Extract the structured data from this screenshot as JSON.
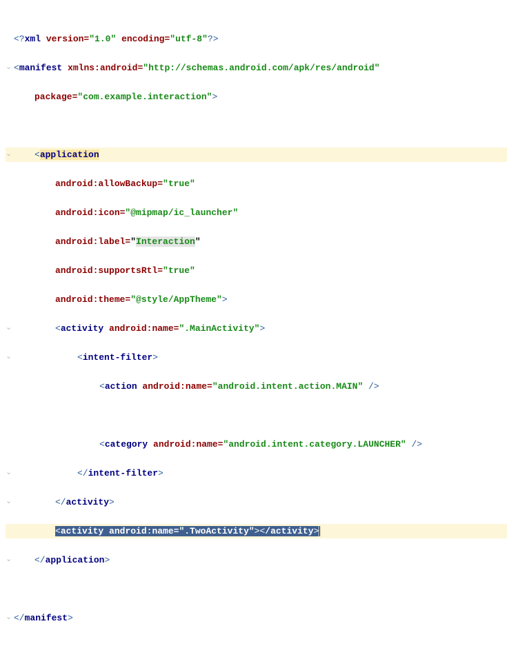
{
  "gutter": {
    "collapse": "⌄"
  },
  "line1": {
    "open": "<?",
    "tag": "xml",
    "attr1": "version=",
    "val1": "\"1.0\"",
    "attr2": " encoding=",
    "val2": "\"utf-8\"",
    "close": "?>"
  },
  "line2": {
    "open": "<",
    "tag": "manifest",
    "attr1": " xmlns:android=",
    "val1": "\"http://schemas.android.com/apk/res/android\""
  },
  "line3": {
    "attr": "package=",
    "val": "\"com.example.interaction\"",
    "close": ">"
  },
  "line5": {
    "open": "<",
    "tag": "application"
  },
  "line6": {
    "attr": "android:allowBackup=",
    "val": "\"true\""
  },
  "line7": {
    "attr": "android:icon=",
    "val": "\"@mipmap/ic_launcher\""
  },
  "line8": {
    "attr": "android:label=",
    "q1": "\"",
    "val": "Interaction",
    "q2": "\""
  },
  "line9": {
    "attr": "android:supportsRtl=",
    "val": "\"true\""
  },
  "line10": {
    "attr": "android:theme=",
    "val": "\"@style/AppTheme\"",
    "close": ">"
  },
  "line11": {
    "open": "<",
    "tag": "activity",
    "attr": " android:name=",
    "val": "\".MainActivity\"",
    "close": ">"
  },
  "line12": {
    "open": "<",
    "tag": "intent-filter",
    "close": ">"
  },
  "line13": {
    "open": "<",
    "tag": "action",
    "attr": " android:name=",
    "val": "\"android.intent.action.MAIN\"",
    "close": " />"
  },
  "line15": {
    "open": "<",
    "tag": "category",
    "attr": " android:name=",
    "val": "\"android.intent.category.LAUNCHER\"",
    "close": " />"
  },
  "line16": {
    "open": "</",
    "tag": "intent-filter",
    "close": ">"
  },
  "line17": {
    "open": "</",
    "tag": "activity",
    "close": ">"
  },
  "line18": {
    "open": "<",
    "tag": "activity",
    "attr": " android:name=",
    "val": "\".TwoActivity\"",
    "mid": "><",
    "tag2": "/activity",
    "close": ">"
  },
  "line19": {
    "open": "</",
    "tag": "application",
    "close": ">"
  },
  "line21": {
    "open": "</",
    "tag": "manifest",
    "close": ">"
  }
}
